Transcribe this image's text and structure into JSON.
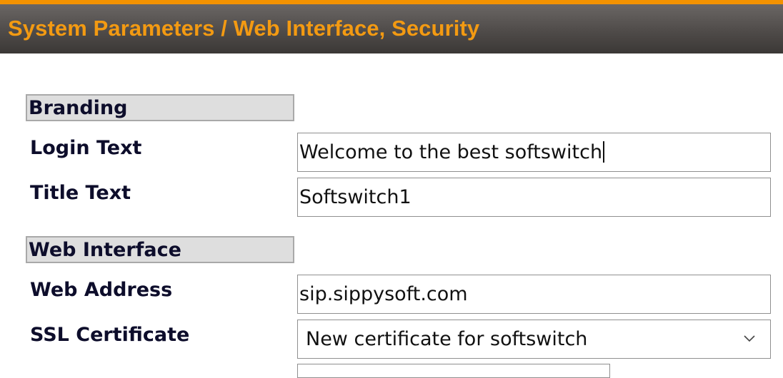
{
  "header": {
    "title": "System Parameters / Web Interface, Security"
  },
  "sections": {
    "branding": {
      "title": "Branding",
      "login_text": {
        "label": "Login Text",
        "value": "Welcome to the best softswitch"
      },
      "title_text": {
        "label": "Title Text",
        "value": "Softswitch1"
      }
    },
    "web_interface": {
      "title": "Web Interface",
      "web_address": {
        "label": "Web Address",
        "value": "sip.sippysoft.com"
      },
      "ssl_certificate": {
        "label": "SSL Certificate",
        "selected": "New certificate for softswitch"
      }
    }
  },
  "colors": {
    "accent_orange": "#f39200",
    "header_bg": "#4f4b49",
    "section_bg": "#dedede",
    "label_text": "#0d0d2b"
  },
  "icons": {
    "select_arrow": "chevron-down-icon"
  }
}
